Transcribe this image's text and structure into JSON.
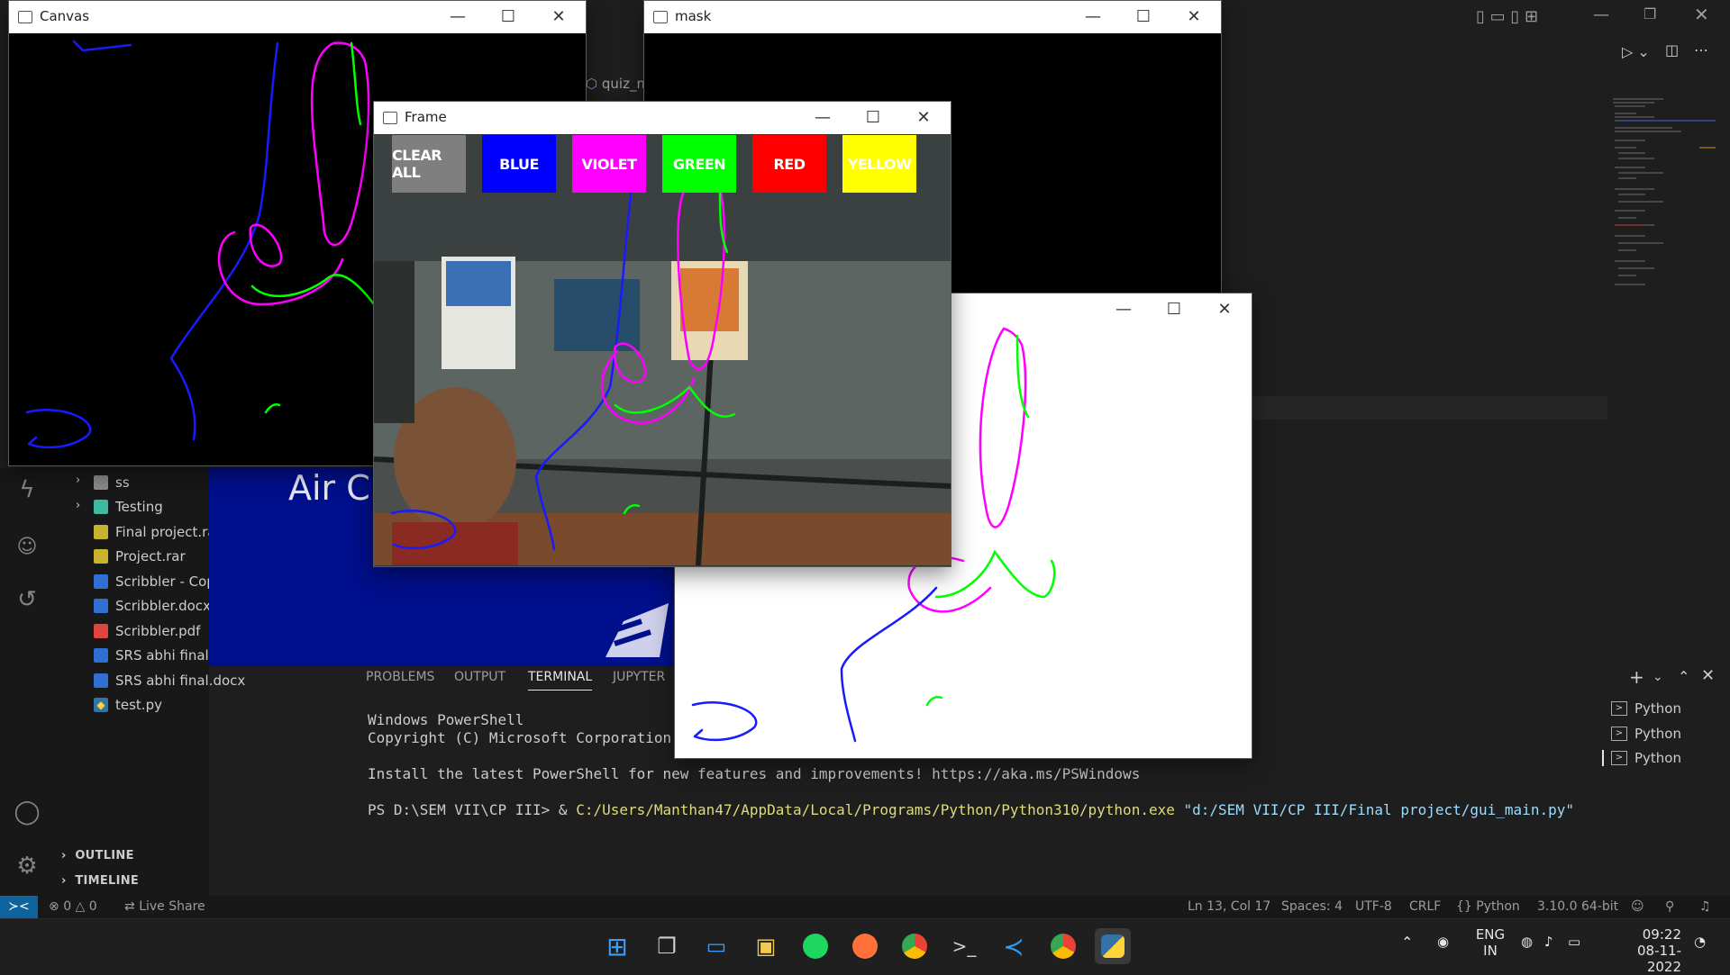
{
  "windows": {
    "canvas": {
      "title": "Canvas"
    },
    "mask": {
      "title": "mask"
    },
    "frame": {
      "title": "Frame"
    },
    "paint": {
      "title": ""
    }
  },
  "frame_buttons": [
    {
      "label": "CLEAR ALL",
      "color": "#7f7f7f"
    },
    {
      "label": "BLUE",
      "color": "#0000ff"
    },
    {
      "label": "VIOLET",
      "color": "#ff00ff"
    },
    {
      "label": "GREEN",
      "color": "#00ff00"
    },
    {
      "label": "RED",
      "color": "#ff0000"
    },
    {
      "label": "YELLOW",
      "color": "#ffff00"
    }
  ],
  "editor": {
    "tab_partial": "quiz_m",
    "banner_title": "Air C"
  },
  "explorer": {
    "items": [
      {
        "label": "ss",
        "type": "folder"
      },
      {
        "label": "Testing",
        "type": "folder"
      },
      {
        "label": "Final project.ra",
        "type": "rar"
      },
      {
        "label": "Project.rar",
        "type": "rar"
      },
      {
        "label": "Scribbler - Cop",
        "type": "docx"
      },
      {
        "label": "Scribbler.docx",
        "type": "docx"
      },
      {
        "label": "Scribbler.pdf",
        "type": "pdf"
      },
      {
        "label": "SRS abhi final",
        "type": "docx"
      },
      {
        "label": "SRS abhi final.docx",
        "type": "docx"
      },
      {
        "label": "test.py",
        "type": "py"
      }
    ],
    "sections": [
      "OUTLINE",
      "TIMELINE"
    ]
  },
  "panel": {
    "tabs": [
      "PROBLEMS",
      "OUTPUT",
      "TERMINAL",
      "JUPYTER"
    ],
    "active_tab": "TERMINAL",
    "terminal_lines": [
      "Windows PowerShell",
      "Copyright (C) Microsoft Corporation. A",
      "",
      "Install the latest PowerShell for new features and improvements! https://aka.ms/PSWindows",
      ""
    ],
    "prompt": "PS D:\\SEM VII\\CP III> & ",
    "command_exe": "C:/Users/Manthan47/AppData/Local/Programs/Python/Python310/python.exe",
    "command_arg": "\"d:/SEM VII/CP III/Final project/gui_main.py\"",
    "terminal_sessions": [
      "Python",
      "Python",
      "Python"
    ]
  },
  "status_bar": {
    "errors": "0",
    "warnings": "0",
    "live_share": "Live Share",
    "cursor": "Ln 13, Col 17",
    "spaces": "Spaces: 4",
    "encoding": "UTF-8",
    "eol": "CRLF",
    "language": "Python",
    "interpreter": "3.10.0 64-bit"
  },
  "taskbar": {
    "apps": [
      "start-icon",
      "task-view-icon",
      "desktop-icon",
      "store-icon",
      "spotify-icon",
      "firefox-icon",
      "chrome-icon",
      "terminal-icon",
      "vscode-icon",
      "chrome-profile-icon",
      "python-icon"
    ],
    "lang_top": "ENG",
    "lang_bottom": "IN",
    "time": "09:22",
    "date": "08-11-2022"
  }
}
